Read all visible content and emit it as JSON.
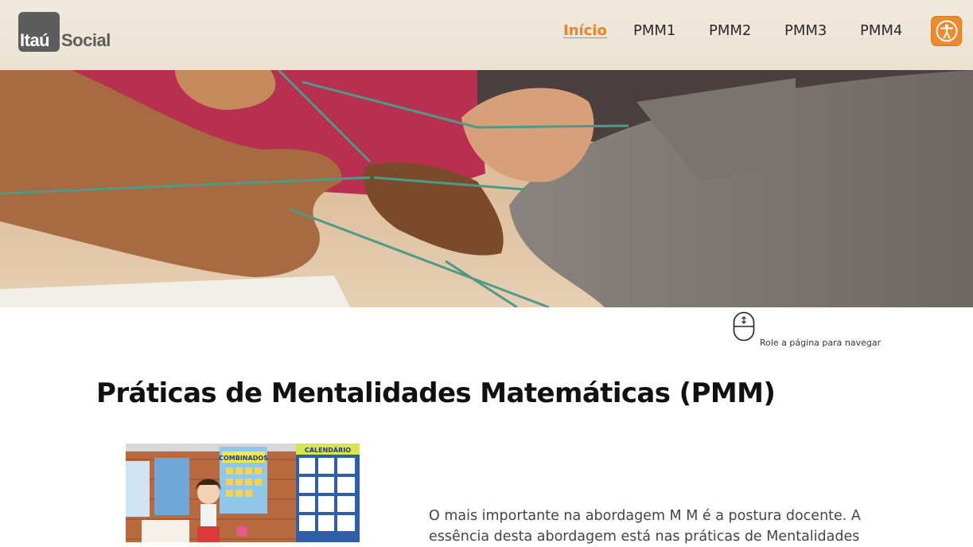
{
  "header": {
    "logo": {
      "part1": "Itaú",
      "part2": "Social"
    },
    "nav": [
      {
        "label": "Início",
        "active": true
      },
      {
        "label": "PMM1",
        "active": false
      },
      {
        "label": "PMM2",
        "active": false
      },
      {
        "label": "PMM3",
        "active": false
      },
      {
        "label": "PMM4",
        "active": false
      }
    ],
    "accessibility_icon": "accessibility-person-icon"
  },
  "hero": {
    "image_description": "children's hands holding green string"
  },
  "scroll_hint": {
    "icon": "mouse-scroll-icon",
    "label": "Role a página para navegar"
  },
  "main": {
    "title": "Práticas de Mentalidades Matemáticas (PMM)",
    "image_labels": [
      "COMBINADOS",
      "CALENDÁRIO"
    ],
    "paragraph": "O mais importante na abordagem M M é a postura docente. A essência desta abordagem está nas práticas de Mentalidades"
  },
  "colors": {
    "accent": "#e8862a",
    "header_bg": "#ede5d8",
    "logo_gray": "#5d5d5d",
    "text": "#111111"
  }
}
